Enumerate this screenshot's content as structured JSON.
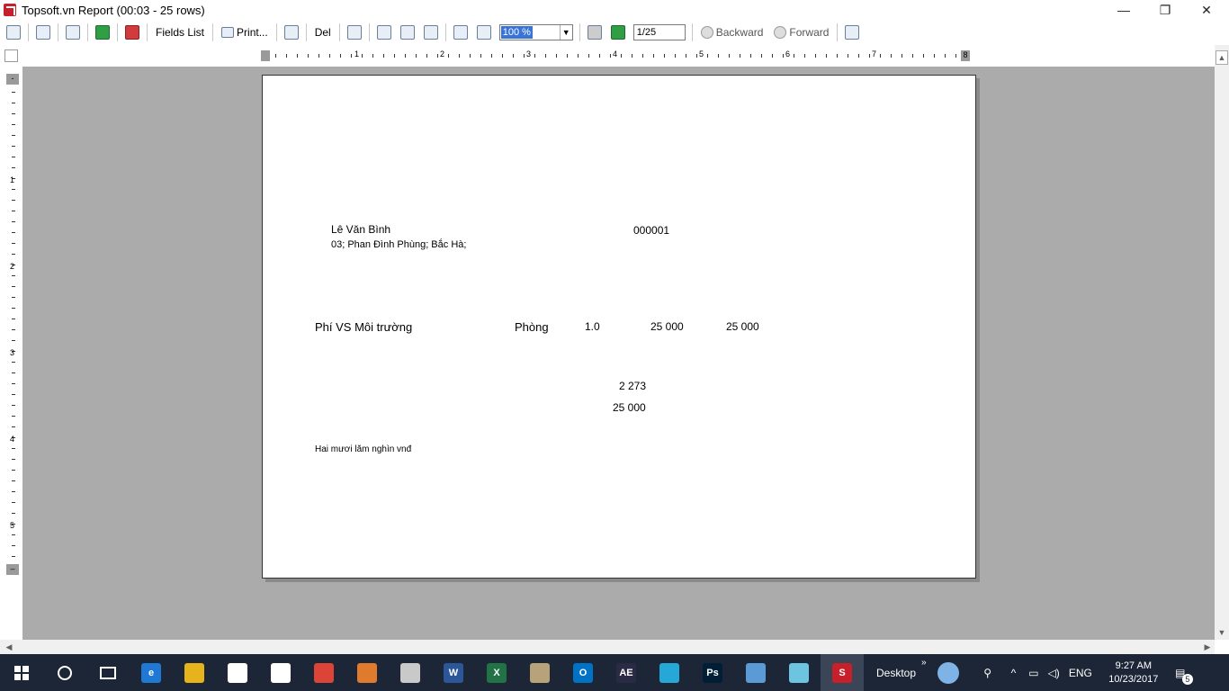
{
  "window": {
    "title": "Topsoft.vn Report (00:03 - 25 rows)",
    "minimize_glyph": "—",
    "maximize_glyph": "❐",
    "close_glyph": "✕"
  },
  "toolbar": {
    "fields_list_label": "Fields List",
    "print_label": "Print...",
    "del_label": "Del",
    "zoom_value": "100 %",
    "page_value": "1/25",
    "backward_label": "Backward",
    "forward_label": "Forward"
  },
  "ruler": {
    "h_numbers": [
      "1",
      "2",
      "3",
      "4",
      "5",
      "6",
      "7"
    ],
    "h_end_cap": "8",
    "v_numbers": [
      "1",
      "2",
      "3",
      "4",
      "5"
    ],
    "v_top_cap": "-",
    "v_bottom_cap": "–"
  },
  "report": {
    "customer_name": "Lê Văn Bình",
    "customer_address": "03; Phan Đình Phùng; Bắc Hà;",
    "invoice_number": "000001",
    "item_name": "Phí VS Môi trường",
    "unit": "Phòng",
    "quantity": "1.0",
    "unit_price": "25 000",
    "amount": "25 000",
    "tax": "2 273",
    "total": "25 000",
    "amount_in_words": "Hai mươi lăm nghìn vnđ"
  },
  "taskbar": {
    "items": [
      {
        "name": "edge",
        "glyph": "e",
        "color": "#1e78d4"
      },
      {
        "name": "file-explorer",
        "glyph": "",
        "color": "#e8b21c"
      },
      {
        "name": "store",
        "glyph": "",
        "color": "#ffffff"
      },
      {
        "name": "mail",
        "glyph": "",
        "color": "#ffffff"
      },
      {
        "name": "chrome",
        "glyph": "",
        "color": "#db4437"
      },
      {
        "name": "paint-app",
        "glyph": "",
        "color": "#e07a2c"
      },
      {
        "name": "tools-app",
        "glyph": "",
        "color": "#c9c9c9"
      },
      {
        "name": "word",
        "glyph": "W",
        "color": "#2b579a"
      },
      {
        "name": "excel",
        "glyph": "X",
        "color": "#217346"
      },
      {
        "name": "archive-app",
        "glyph": "",
        "color": "#b7a27a"
      },
      {
        "name": "outlook",
        "glyph": "O",
        "color": "#0072c6"
      },
      {
        "name": "after-effects",
        "glyph": "AE",
        "color": "#2a2a44"
      },
      {
        "name": "color-app",
        "glyph": "",
        "color": "#25a7d8"
      },
      {
        "name": "photoshop",
        "glyph": "Ps",
        "color": "#001e36"
      },
      {
        "name": "paint-brush-app",
        "glyph": "",
        "color": "#5b9bd5"
      },
      {
        "name": "notes-app",
        "glyph": "",
        "color": "#6cc4e0"
      },
      {
        "name": "topsoft-app",
        "glyph": "S",
        "color": "#c8202a"
      }
    ],
    "desktop_label": "Desktop",
    "language": "ENG",
    "time": "9:27 AM",
    "date": "10/23/2017",
    "notification_count": "5"
  }
}
